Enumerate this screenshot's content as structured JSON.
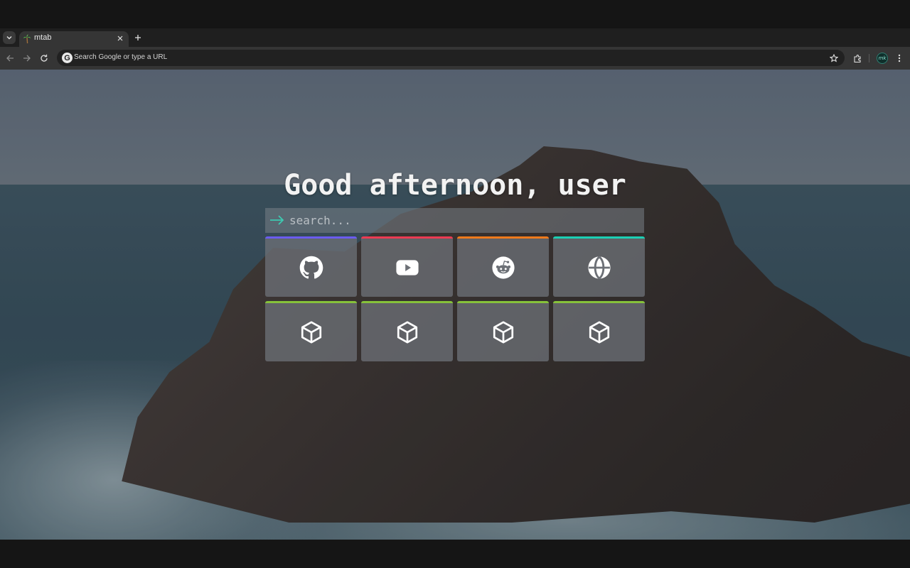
{
  "browser": {
    "tab": {
      "title": "mtab"
    },
    "omnibox": {
      "placeholder": "Search Google or type a URL"
    },
    "profile": {
      "initials": "mk"
    }
  },
  "page": {
    "greeting": "Good afternoon, user",
    "search": {
      "placeholder": "search..."
    },
    "accent": "#3ec9b0",
    "tiles": [
      {
        "icon": "github-icon",
        "color": "#6b5cf0"
      },
      {
        "icon": "youtube-icon",
        "color": "#ec3b53"
      },
      {
        "icon": "reddit-icon",
        "color": "#f07a1c"
      },
      {
        "icon": "globe-icon",
        "color": "#1ccfb4"
      },
      {
        "icon": "cube-icon",
        "color": "#86c23a"
      },
      {
        "icon": "cube-icon",
        "color": "#86c23a"
      },
      {
        "icon": "cube-icon",
        "color": "#86c23a"
      },
      {
        "icon": "cube-icon",
        "color": "#86c23a"
      }
    ]
  }
}
